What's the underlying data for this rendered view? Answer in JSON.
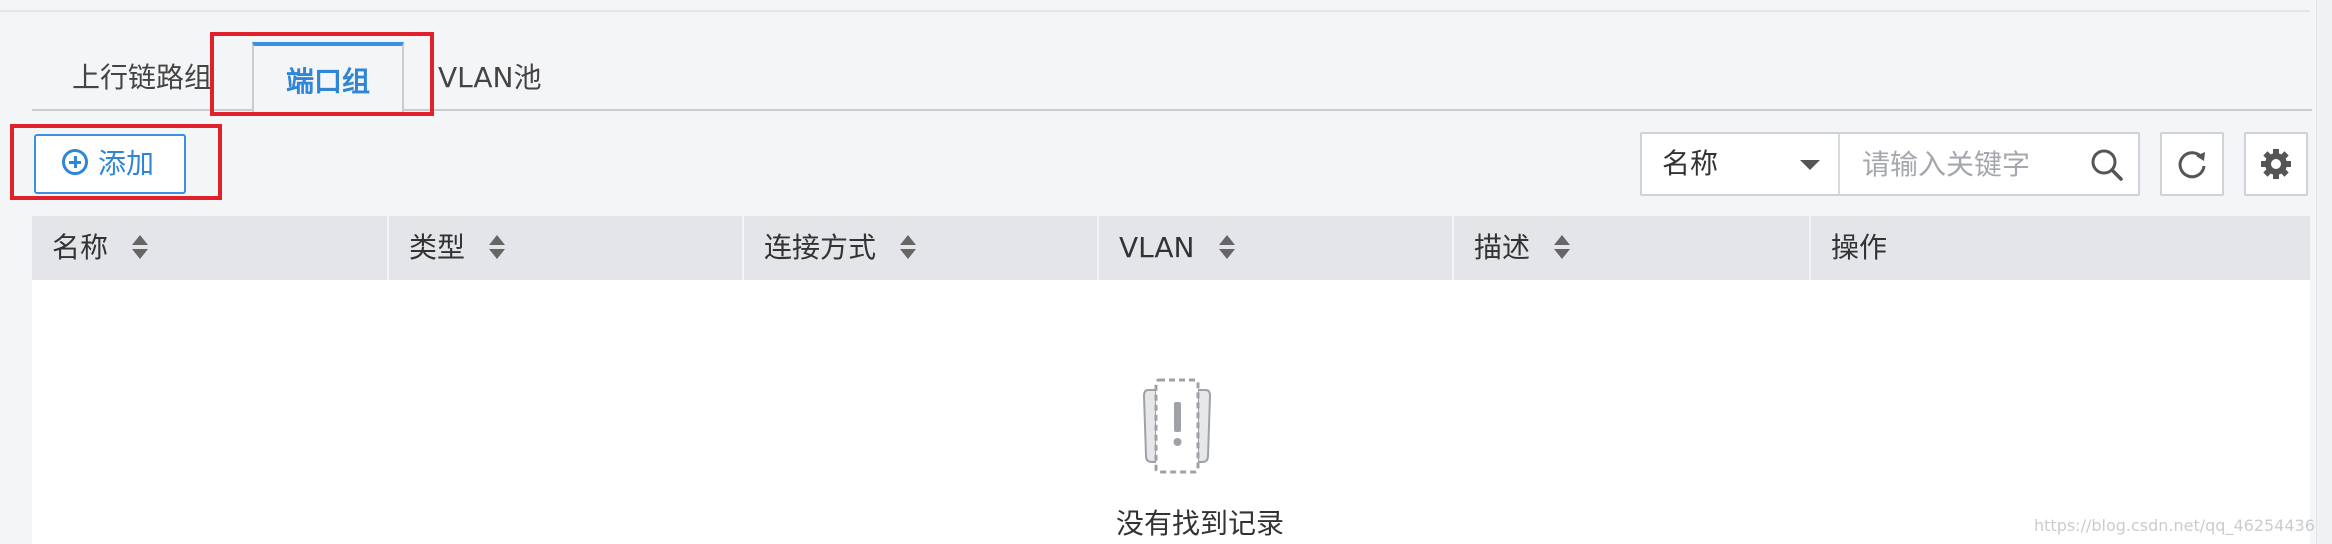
{
  "tabs": [
    {
      "label": "上行链路组",
      "active": false
    },
    {
      "label": "端口组",
      "active": true
    },
    {
      "label": "VLAN池",
      "active": false
    }
  ],
  "toolbar": {
    "add_label": "添加",
    "search_field": "名称",
    "search_placeholder": "请输入关键字",
    "icons": [
      "search-icon",
      "refresh-icon",
      "settings-icon"
    ]
  },
  "table": {
    "columns": [
      "名称",
      "类型",
      "连接方式",
      "VLAN",
      "描述",
      "操作"
    ],
    "rows": [],
    "empty_text": "没有找到记录"
  },
  "watermark": "https://blog.csdn.net/qq_46254436",
  "colors": {
    "accent": "#2f86d6",
    "highlight": "#e0202a"
  }
}
